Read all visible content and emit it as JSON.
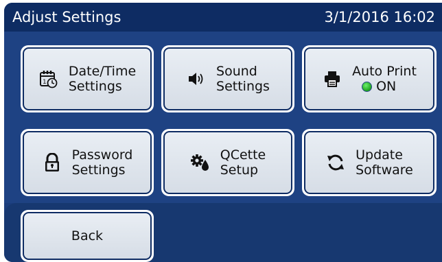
{
  "header": {
    "title": "Adjust Settings",
    "datetime": "3/1/2016 16:02"
  },
  "buttons": {
    "datetime": {
      "line1": "Date/Time",
      "line2": "Settings",
      "icon": "calendar-clock-icon"
    },
    "sound": {
      "line1": "Sound",
      "line2": "Settings",
      "icon": "speaker-icon"
    },
    "autoprint": {
      "line1": "Auto Print",
      "status": "ON",
      "status_color": "#2ec52e",
      "icon": "printer-icon"
    },
    "password": {
      "line1": "Password",
      "line2": "Settings",
      "icon": "lock-icon"
    },
    "qcette": {
      "line1": "QCette",
      "line2": "Setup",
      "icon": "gear-drop-icon"
    },
    "update": {
      "line1": "Update",
      "line2": "Software",
      "icon": "refresh-icon"
    }
  },
  "footer": {
    "back_label": "Back"
  },
  "colors": {
    "title_bar": "#0e2c63",
    "background": "#1e4283",
    "button_face": "#e3e8ef"
  }
}
